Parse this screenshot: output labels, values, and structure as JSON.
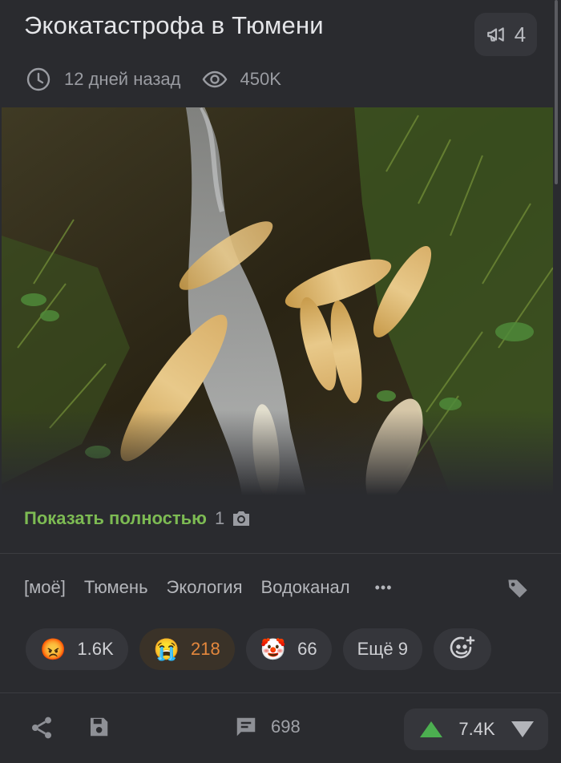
{
  "post": {
    "title": "Экокатастрофа в Тюмени",
    "megaphone_count": "4",
    "time_ago": "12 дней назад",
    "views": "450K",
    "show_full_label": "Показать полностью",
    "photo_count": "1"
  },
  "tags": [
    "[моё]",
    "Тюмень",
    "Экология",
    "Водоканал"
  ],
  "more_tags_label": "•••",
  "reactions": [
    {
      "emoji": "😡",
      "count": "1.6K"
    },
    {
      "emoji": "😭",
      "count": "218"
    },
    {
      "emoji": "🤡",
      "count": "66"
    }
  ],
  "more_reactions_label": "Ещё 9",
  "footer": {
    "comments": "698",
    "rating": "7.4K"
  },
  "colors": {
    "background": "#2a2b2f",
    "accent_green": "#7dbb53",
    "active_reaction": "#e5883d",
    "upvote": "#4caf50"
  },
  "icons": [
    "megaphone-icon",
    "clock-icon",
    "eye-icon",
    "camera-icon",
    "tag-icon",
    "add-reaction-icon",
    "share-icon",
    "save-icon",
    "comment-icon",
    "upvote-icon",
    "downvote-icon"
  ]
}
